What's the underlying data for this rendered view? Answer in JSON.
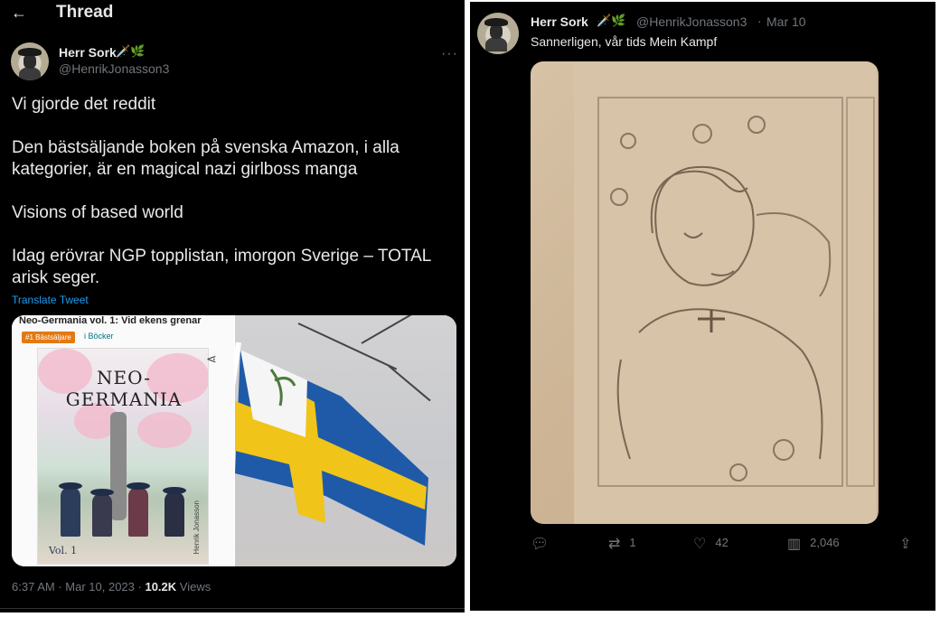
{
  "thread": {
    "title": "Thread",
    "back_icon": "arrow-left-icon"
  },
  "main_tweet": {
    "author_name": "Herr Sork",
    "author_emoji": "🗡️🌿",
    "author_handle": "@HenrikJonasson3",
    "paragraphs": [
      "Vi gjorde det reddit",
      "Den bästsäljande boken på svenska Amazon, i alla kategorier, är en magical nazi girlboss manga",
      "Visions of based world",
      "Idag erövrar NGP topplistan, imorgon Sverige – TOTAL arisk seger."
    ],
    "translate_label": "Translate Tweet",
    "media_book": {
      "header_text": "Neo-Germania vol. 1: Vid ekens grenar",
      "badge": "#1 Bästsäljare",
      "category": "i Böcker",
      "cover_title": "NEO-GERMANIA",
      "volume": "Vol. 1",
      "cover_author": "Henrik Jonasson"
    },
    "time": "6:37 AM",
    "date": "Mar 10, 2023",
    "views_count": "10.2K",
    "views_label": "Views"
  },
  "reply_tweet": {
    "author_name": "Herr Sork",
    "author_emoji": "🗡️🌿",
    "author_handle": "@HenrikJonasson3",
    "separator": "·",
    "date": "Mar 10",
    "text": "Sannerligen, vår tids Mein Kampf",
    "actions": {
      "reply_count": "",
      "retweet_count": "1",
      "like_count": "42",
      "views_count": "2,046"
    }
  },
  "colors": {
    "background": "#000000",
    "text": "#e7e9ea",
    "muted": "#71767b",
    "link": "#1d9bf0",
    "flag_blue": "#1d5aa6",
    "flag_yellow": "#f1c40f"
  }
}
